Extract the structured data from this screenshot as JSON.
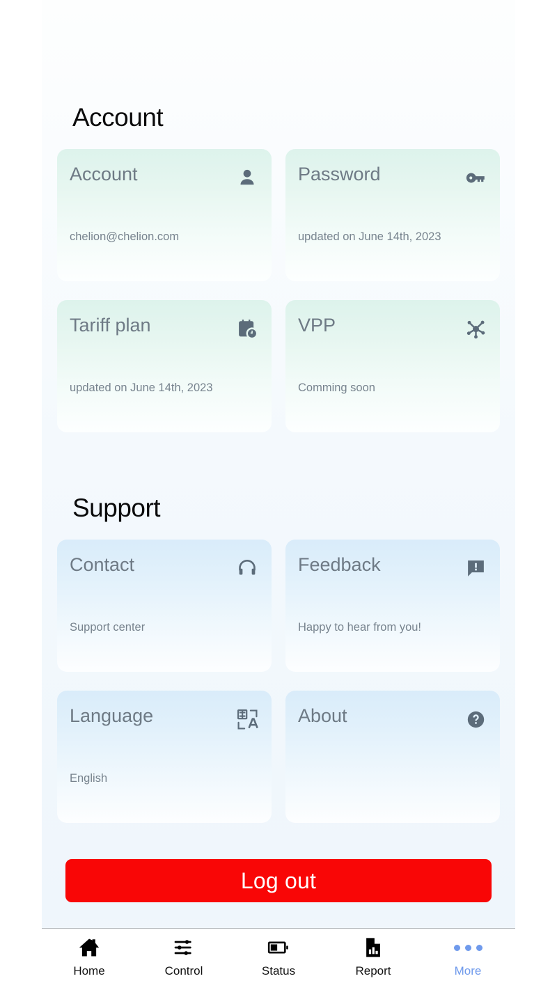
{
  "theme": {
    "panel_bg": "#f2f8fd",
    "green_card": "#ddf3ec",
    "blue_card": "#d9ecfa",
    "icon_color": "#5c6c7a",
    "title_color": "#6e7a85",
    "logout_red": "#f90606",
    "nav_active": "#6f9aec",
    "nav_inactive": "#111111"
  },
  "sections": [
    {
      "id": "account",
      "title": "Account",
      "cards": [
        {
          "title": "Account",
          "subtitle": "chelion@chelion.com",
          "icon": "person-icon",
          "tone": "green"
        },
        {
          "title": "Password",
          "subtitle": "updated on June 14th, 2023",
          "icon": "key-icon",
          "tone": "green"
        },
        {
          "title": "Tariff plan",
          "subtitle": "updated on June 14th, 2023",
          "icon": "calendar-clock-icon",
          "tone": "green"
        },
        {
          "title": "VPP",
          "subtitle": "Comming soon",
          "icon": "network-hub-icon",
          "tone": "green"
        }
      ]
    },
    {
      "id": "support",
      "title": "Support",
      "cards": [
        {
          "title": "Contact",
          "subtitle": "Support center",
          "icon": "headset-icon",
          "tone": "blue"
        },
        {
          "title": "Feedback",
          "subtitle": "Happy to hear from you!",
          "icon": "feedback-icon",
          "tone": "blue"
        },
        {
          "title": "Language",
          "subtitle": "English",
          "icon": "translate-icon",
          "tone": "blue"
        },
        {
          "title": "About",
          "subtitle": "",
          "icon": "help-circle-icon",
          "tone": "blue"
        }
      ]
    }
  ],
  "logout": {
    "label": "Log out"
  },
  "navbar": {
    "items": [
      {
        "label": "Home",
        "icon": "home-icon",
        "active": false
      },
      {
        "label": "Control",
        "icon": "sliders-icon",
        "active": false
      },
      {
        "label": "Status",
        "icon": "battery-half-icon",
        "active": false
      },
      {
        "label": "Report",
        "icon": "document-chart-icon",
        "active": false
      },
      {
        "label": "More",
        "icon": "ellipsis-icon",
        "active": true
      }
    ]
  }
}
